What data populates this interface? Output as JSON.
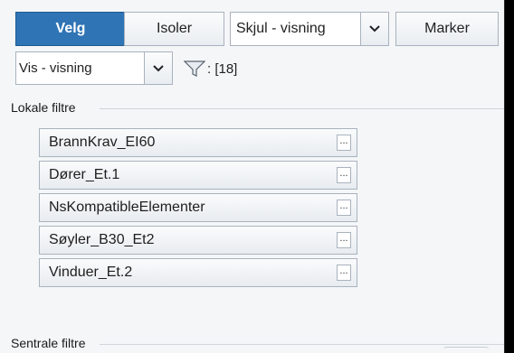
{
  "toolbar": {
    "select_label": "Velg",
    "isolate_label": "Isoler",
    "hide_view_value": "Skjul - visning",
    "mark_label": "Marker"
  },
  "view_row": {
    "show_view_value": "Vis - visning",
    "filter_count": ": [18]"
  },
  "local_filters": {
    "title": "Lokale filtre",
    "items": [
      {
        "label": "BrannKrav_EI60",
        "options": "..."
      },
      {
        "label": "Dører_Et.1",
        "options": "..."
      },
      {
        "label": "NsKompatibleElementer",
        "options": "..."
      },
      {
        "label": "Søyler_B30_Et2",
        "options": "..."
      },
      {
        "label": "Vinduer_Et.2",
        "options": "..."
      }
    ]
  },
  "central_filters": {
    "title": "Sentrale filtre"
  },
  "colors": {
    "primary": "#2f74b5",
    "background": "#f4f6f8",
    "border": "#a9b3be"
  },
  "icons": {
    "dropdown": "chevron-down-icon",
    "filter": "funnel-icon"
  }
}
